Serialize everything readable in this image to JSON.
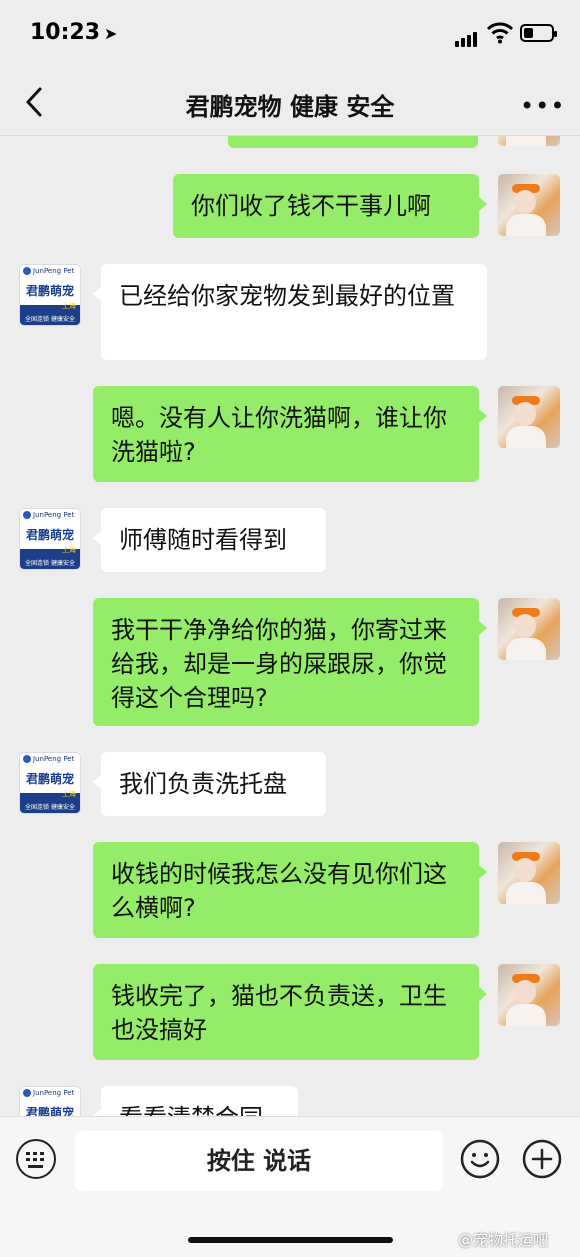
{
  "status_bar": {
    "time": "10:23",
    "location_arrow": "➤"
  },
  "header": {
    "back_icon": "chevron-left-icon",
    "title": "君鹏宠物 健康 安全",
    "more_label": "•••"
  },
  "shop_avatar": {
    "top_text": "JunPeng Pet",
    "brand": "君鹏萌宠",
    "city": "上海",
    "band": "全国连锁 健康安全"
  },
  "messages": [
    {
      "sender": "me",
      "text": ""
    },
    {
      "sender": "me",
      "text": "你们收了钱不干事儿啊"
    },
    {
      "sender": "shop",
      "text": "已经给你家宠物发到最好的位置"
    },
    {
      "sender": "me",
      "text": "嗯。没有人让你洗猫啊，谁让你洗猫啦?"
    },
    {
      "sender": "shop",
      "text": "师傅随时看得到"
    },
    {
      "sender": "me",
      "text": "我干干净净给你的猫，你寄过来给我，却是一身的屎跟尿，你觉得这个合理吗?"
    },
    {
      "sender": "shop",
      "text": "我们负责洗托盘"
    },
    {
      "sender": "me",
      "text": "收钱的时候我怎么没有见你们这么横啊?"
    },
    {
      "sender": "me",
      "text": "钱收完了，猫也不负责送，卫生也没搞好"
    },
    {
      "sender": "shop",
      "text": "看看清楚合同"
    }
  ],
  "input_bar": {
    "hold_to_talk": "按住 说话"
  },
  "watermark": "@宠物托运吧",
  "colors": {
    "my_bubble": "#95ec69",
    "their_bubble": "#ffffff",
    "background": "#ededed"
  }
}
